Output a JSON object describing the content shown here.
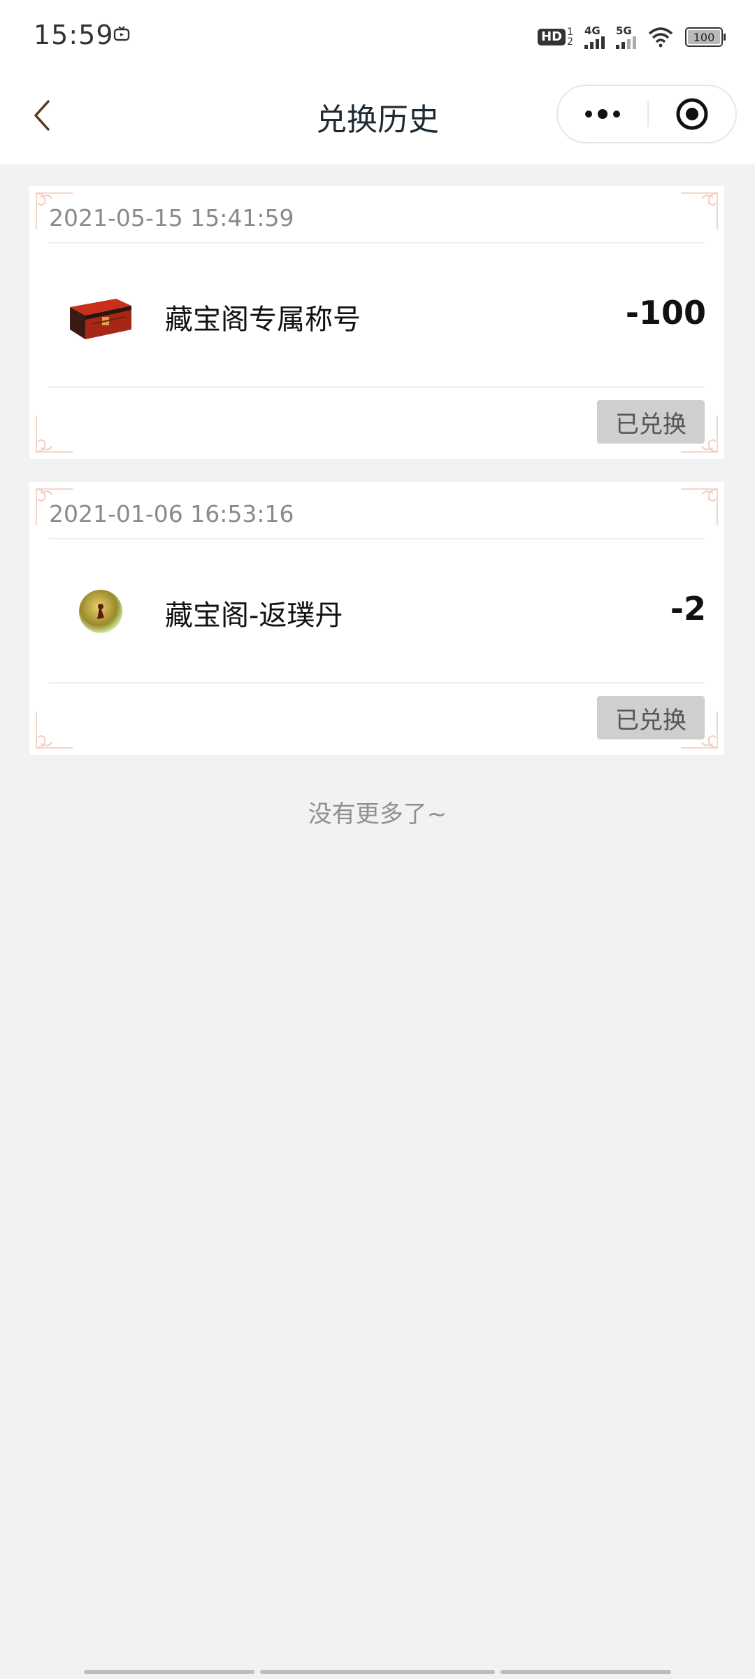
{
  "status_bar": {
    "time": "15:59",
    "hd_label": "HD",
    "hd_sub": "1\n2",
    "net1_label": "4G",
    "net2_label": "5G",
    "battery_level": "100",
    "icons": [
      "tv-icon",
      "hd-icon",
      "signal-4g-icon",
      "signal-5g-icon",
      "wifi-icon",
      "battery-icon"
    ]
  },
  "navbar": {
    "title": "兑换历史",
    "icons": [
      "back-chevron-icon",
      "more-dots-icon",
      "close-target-icon"
    ]
  },
  "records": [
    {
      "date": "2021-05-15 15:41:59",
      "item_name": "藏宝阁专属称号",
      "amount": "-100",
      "status": "已兑换",
      "icon": "treasure-chest-icon"
    },
    {
      "date": "2021-01-06 16:53:16",
      "item_name": "藏宝阁-返璞丹",
      "amount": "-2",
      "status": "已兑换",
      "icon": "pill-orb-icon"
    }
  ],
  "footer": {
    "no_more": "没有更多了~"
  },
  "colors": {
    "page_bg": "#f1f2f4",
    "card_bg": "#ffffff",
    "status_button_bg": "#cfcfcf",
    "corner_ornament": "#f4d6c8",
    "title_text": "#1e2a33"
  }
}
